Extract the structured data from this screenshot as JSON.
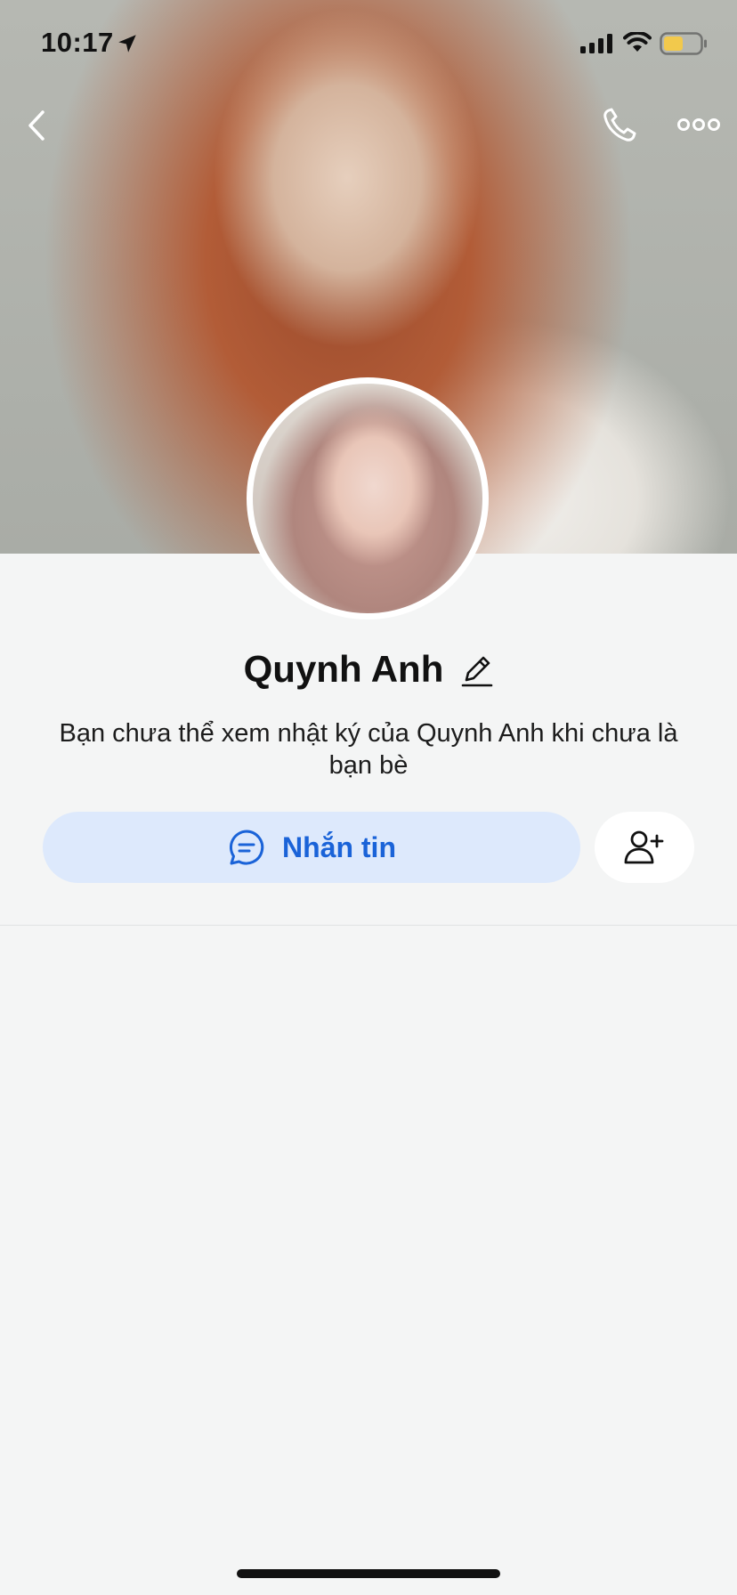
{
  "status_bar": {
    "time": "10:17",
    "icons": [
      "location-arrow-icon",
      "signal-icon",
      "wifi-icon",
      "battery-icon"
    ],
    "battery_color": "#f2c94c"
  },
  "nav": {
    "back_icon": "chevron-left-icon",
    "call_icon": "phone-icon",
    "more_icon": "more-dots-icon"
  },
  "profile": {
    "name": "Quynh Anh",
    "edit_icon": "pencil-icon",
    "info_text": "Bạn chưa thể xem nhật ký của Quynh Anh khi chưa là bạn bè"
  },
  "actions": {
    "message_label": "Nhắn tin",
    "message_icon": "chat-bubble-icon",
    "add_friend_icon": "add-friend-icon"
  },
  "colors": {
    "accent": "#1a63d8",
    "message_button_bg": "#dde9fc",
    "page_bg": "#f4f5f5"
  }
}
